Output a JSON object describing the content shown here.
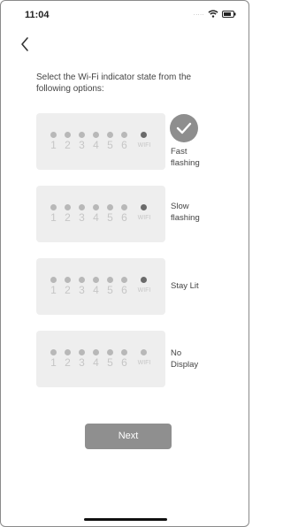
{
  "status_bar": {
    "time": "11:04",
    "signal_text": ".....",
    "wifi_icon": "wifi-icon",
    "battery_icon": "battery-icon"
  },
  "nav": {
    "back_icon": "chevron-left-icon"
  },
  "instruction": "Select the Wi-Fi indicator state from the following options:",
  "indicator_labels": [
    "1",
    "2",
    "3",
    "4",
    "5",
    "6",
    "WIFI"
  ],
  "options": [
    {
      "label_line1": "Fast",
      "label_line2": "flashing",
      "selected": true,
      "wifi_led_on": true
    },
    {
      "label_line1": "Slow",
      "label_line2": "flashing",
      "selected": false,
      "wifi_led_on": true
    },
    {
      "label_line1": "Stay Lit",
      "label_line2": "",
      "selected": false,
      "wifi_led_on": true
    },
    {
      "label_line1": "No",
      "label_line2": "Display",
      "selected": false,
      "wifi_led_on": false
    }
  ],
  "next_button": "Next",
  "colors": {
    "card": "#eeeeee",
    "led_off": "#b8b8b8",
    "led_on": "#6a6a6a",
    "button": "#8f8f8f",
    "check_badge": "#8e8e8e"
  }
}
